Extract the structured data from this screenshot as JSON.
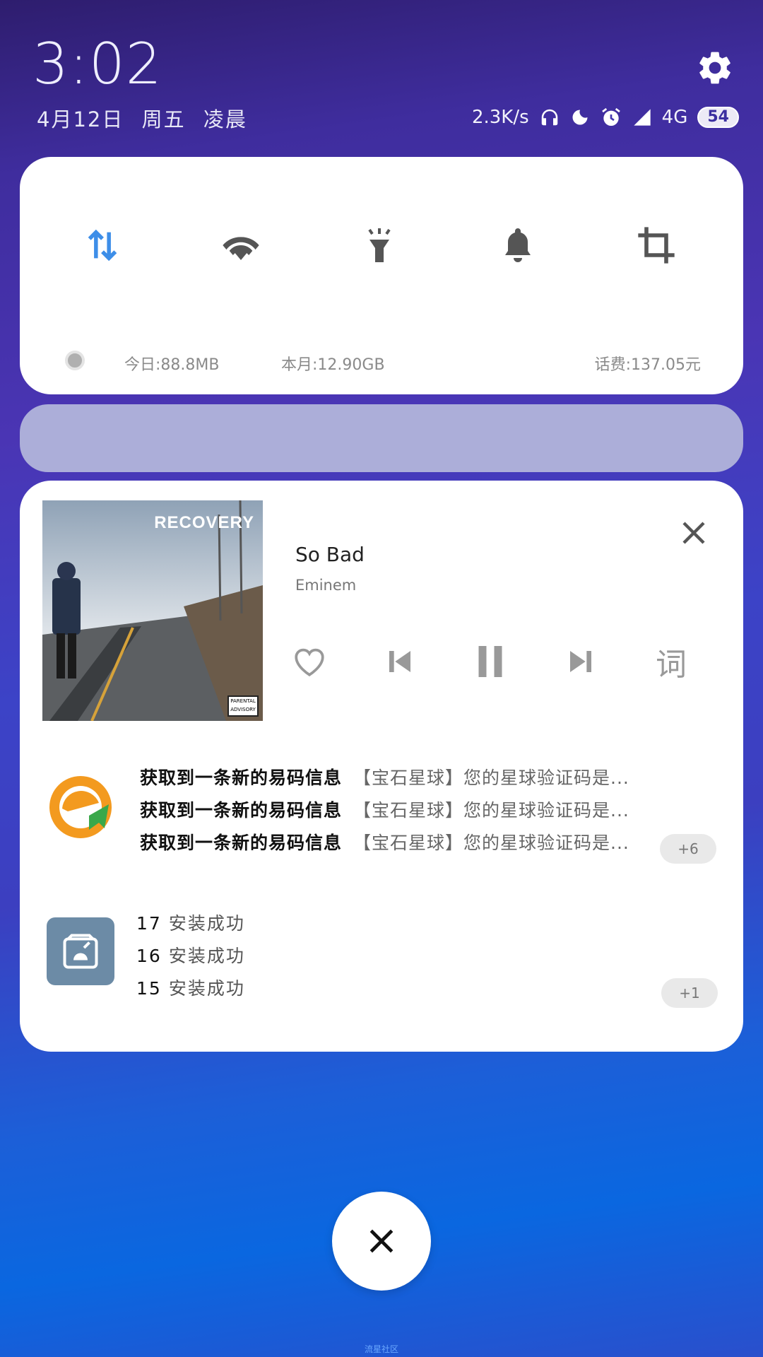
{
  "header": {
    "time": "3:02",
    "date": [
      "4月12日",
      "周五",
      "凌晨"
    ]
  },
  "status": {
    "net_speed": "2.3K/s",
    "network": "4G",
    "battery": "54"
  },
  "quick_settings": {
    "toggles": [
      {
        "name": "mobile-data",
        "active": true
      },
      {
        "name": "wifi",
        "active": false
      },
      {
        "name": "flashlight",
        "active": false
      },
      {
        "name": "sound",
        "active": false
      },
      {
        "name": "screenshot",
        "active": false
      }
    ],
    "usage_today": "今日:88.8MB",
    "usage_month": "本月:12.90GB",
    "balance": "话费:137.05元"
  },
  "media": {
    "album_title": "RECOVERY",
    "song": "So Bad",
    "artist": "Eminem",
    "lyrics_button": "词"
  },
  "notifications": {
    "messages": [
      {
        "title": "获取到一条新的易码信息",
        "body": "【宝石星球】您的星球验证码是..."
      },
      {
        "title": "获取到一条新的易码信息",
        "body": "【宝石星球】您的星球验证码是..."
      },
      {
        "title": "获取到一条新的易码信息",
        "body": "【宝石星球】您的星球验证码是..."
      }
    ],
    "messages_more": "+6",
    "installs": [
      {
        "num": "17",
        "text": "安装成功"
      },
      {
        "num": "16",
        "text": "安装成功"
      },
      {
        "num": "15",
        "text": "安装成功"
      }
    ],
    "installs_more": "+1"
  },
  "colors": {
    "accent_blue": "#3d8ee8",
    "icon_gray": "#555555"
  },
  "watermark": "流星社区"
}
